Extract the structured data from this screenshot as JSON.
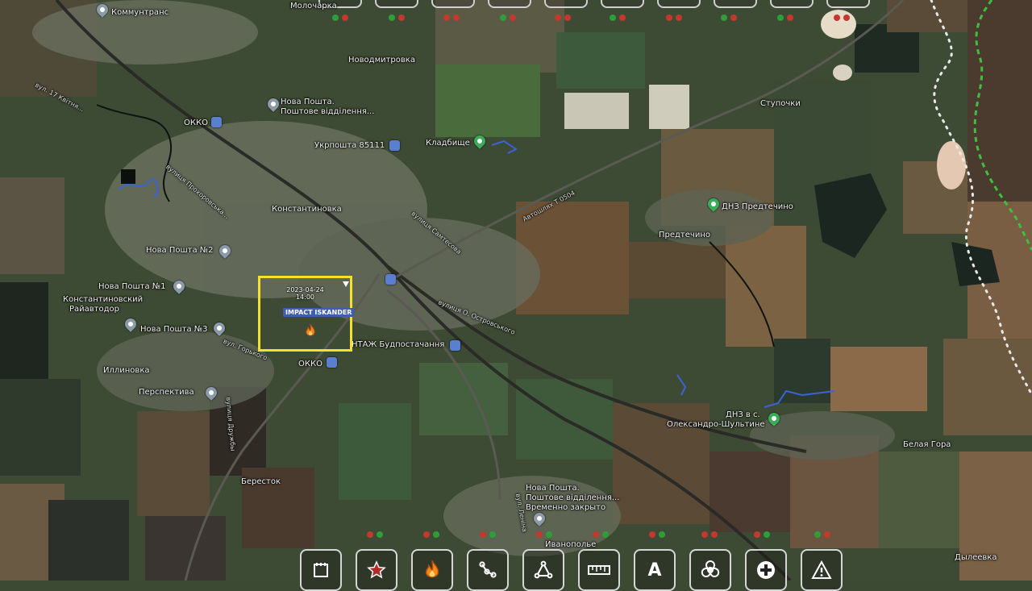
{
  "map": {
    "labels": {
      "kommunstrans": "Коммунтранс",
      "molochka": "Молочарка",
      "novodmitrovka": "Новодмитровка",
      "nova_poshta_1": "Нова Пошта.",
      "nova_poshta_1_sub": "Поштове відділення...",
      "okko_1": "ОККО",
      "ukrposhta": "Укрпошта 85111",
      "kladbische": "Кладбище",
      "stupochki": "Ступочки",
      "konstantinovka": "Константиновка",
      "dnz_predtechino": "ДНЗ Предтечино",
      "predtechino": "Предтечино",
      "nova_poshta_2": "Нова Пошта №2",
      "nova_poshta_n1": "Нова Пошта №1",
      "rayavtodor_1": "Константиновский",
      "rayavtodor_2": "Райавтодор",
      "nova_poshta_3": "Нова Пошта №3",
      "budpostach": "НТАЖ Будпостачання",
      "okko_2": "ОККО",
      "illinovka": "Иллиновка",
      "perspektyva": "Перспектива",
      "dnz_oleksandro_1": "ДНЗ в с.",
      "oleksandro_shultyne": "Олександро-Шультине",
      "bila_gora": "Белая Гора",
      "berestok": "Бересток",
      "nova_poshta_4": "Нова Пошта.",
      "nova_poshta_4_sub": "Поштове відділення...",
      "vremenno_zakryto": "Временно закрыто",
      "ivanopole": "Иванополье",
      "dyleevka": "Дылеевка",
      "road_t0504": "Автошлях Т 0504",
      "road_samatova": "вулиця Самтесова",
      "road_ostrovskogo": "вулиця О. Островського",
      "road_left_1": "вул. 17 Квітня...",
      "road_left_2": "вулиця Прохоровська...",
      "road_left_3": "вул. Горького",
      "road_left_4": "вулиця Дружбы",
      "road_ivanopole": "вул. Леніна"
    },
    "event": {
      "date": "2023-04-24",
      "time": "14:00",
      "label": "IMPACT ISKANDER"
    }
  },
  "toolbar": {
    "icons": [
      "calendar-icon",
      "star-icon",
      "fire-icon",
      "route-icon",
      "triangle-route-icon",
      "ruler-icon",
      "text-icon",
      "biohazard-icon",
      "medical-cross-icon",
      "warning-icon"
    ],
    "text_tool_label": "A"
  },
  "colors": {
    "highlight": "#f5e12a",
    "impact_badge": "#3d5fb0",
    "frontline_green": "#3fbf3f",
    "boundary_white": "#e8e8e8"
  }
}
